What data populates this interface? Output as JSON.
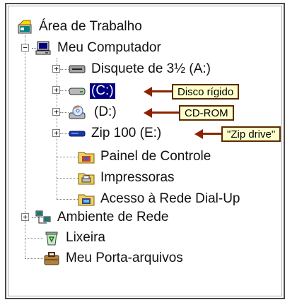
{
  "tree": {
    "desktop": {
      "label": "Área de Trabalho",
      "icon": "desktop-icon"
    },
    "my_computer": {
      "label": "Meu Computador",
      "icon": "computer-icon"
    },
    "floppy": {
      "label": "Disquete de 3½ (A:)",
      "icon": "floppy-drive-icon"
    },
    "c_drive": {
      "label": "(C:)",
      "icon": "hard-disk-icon",
      "selected": true
    },
    "d_drive": {
      "label": "(D:)",
      "icon": "cd-rom-icon"
    },
    "e_drive": {
      "label": "Zip 100 (E:)",
      "icon": "zip-drive-icon"
    },
    "control_panel": {
      "label": "Painel de Controle",
      "icon": "control-panel-icon"
    },
    "printers": {
      "label": "Impressoras",
      "icon": "printers-icon"
    },
    "dialup": {
      "label": "Acesso à Rede Dial-Up",
      "icon": "dialup-icon"
    },
    "network": {
      "label": "Ambiente de Rede",
      "icon": "network-icon"
    },
    "recycle": {
      "label": "Lixeira",
      "icon": "recycle-bin-icon"
    },
    "briefcase": {
      "label": "Meu Porta-arquivos",
      "icon": "briefcase-icon"
    }
  },
  "callouts": {
    "c": "Disco rígido",
    "d": "CD-ROM",
    "e": "\"Zip drive\""
  },
  "colors": {
    "selection": "#000080",
    "callout_bg": "#ffffcc",
    "arrow": "#8b2200"
  }
}
